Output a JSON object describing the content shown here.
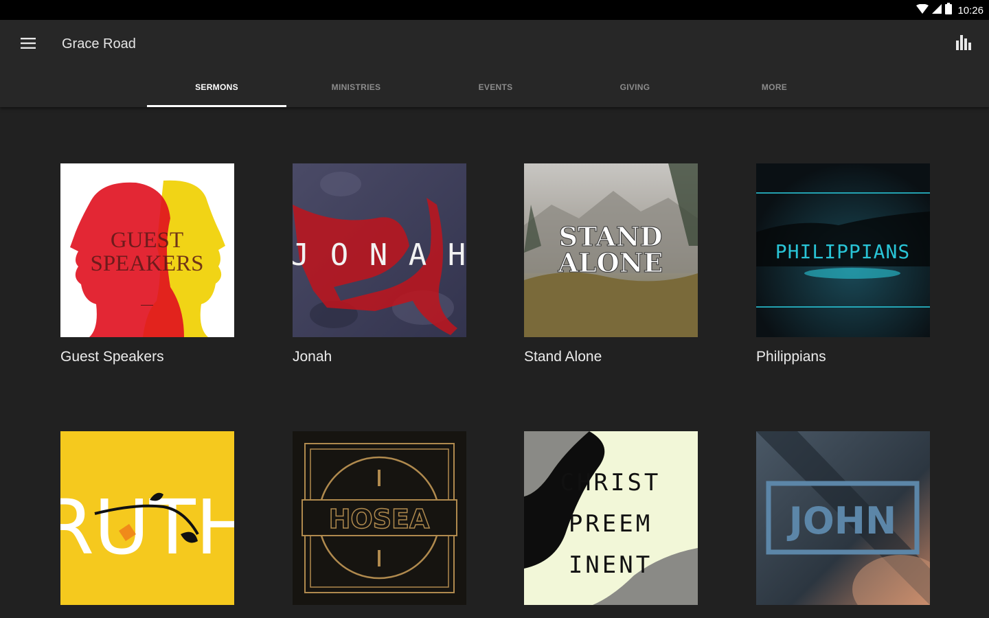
{
  "status": {
    "time": "10:26",
    "wifi_icon": "wifi-icon",
    "signal_icon": "cell-signal-icon",
    "battery_icon": "battery-icon"
  },
  "appbar": {
    "title": "Grace Road",
    "menu_icon": "hamburger-menu-icon",
    "stats_icon": "bar-chart-icon"
  },
  "tabs": [
    {
      "label": "SERMONS",
      "active": true
    },
    {
      "label": "MINISTRIES",
      "active": false
    },
    {
      "label": "EVENTS",
      "active": false
    },
    {
      "label": "GIVING",
      "active": false
    },
    {
      "label": "MORE",
      "active": false
    }
  ],
  "series": [
    {
      "label": "Guest Speakers",
      "art_text": [
        "GUEST",
        "SPEAKERS"
      ],
      "colors": {
        "bg": "#ffffff",
        "a": "#e0101e",
        "b": "#f0d20a"
      }
    },
    {
      "label": "Jonah",
      "art_text": [
        "J O N A H"
      ],
      "colors": {
        "bg": "#3b3d5c",
        "a": "#c0141c"
      }
    },
    {
      "label": "Stand Alone",
      "art_text": [
        "STAND",
        "ALONE"
      ],
      "colors": {
        "bg": "#8e8e8c",
        "a": "#6b6540"
      }
    },
    {
      "label": "Philippians",
      "art_text": [
        "PHILIPPIANS"
      ],
      "colors": {
        "bg": "#0f1518",
        "a": "#29c4d6"
      }
    },
    {
      "label": "",
      "art_text": [
        "RUTH"
      ],
      "colors": {
        "bg": "#f5c91e",
        "a": "#ffffff"
      }
    },
    {
      "label": "",
      "art_text": [
        "HOSEA"
      ],
      "colors": {
        "bg": "#161410",
        "a": "#b08a4e"
      }
    },
    {
      "label": "",
      "art_text": [
        "CHRIST",
        "PREEM",
        "INENT"
      ],
      "colors": {
        "bg": "#f2f7d8",
        "a": "#0d0d0d"
      }
    },
    {
      "label": "",
      "art_text": [
        "JOHN"
      ],
      "colors": {
        "bg": "#3a4652",
        "a": "#5c86a8"
      }
    }
  ]
}
